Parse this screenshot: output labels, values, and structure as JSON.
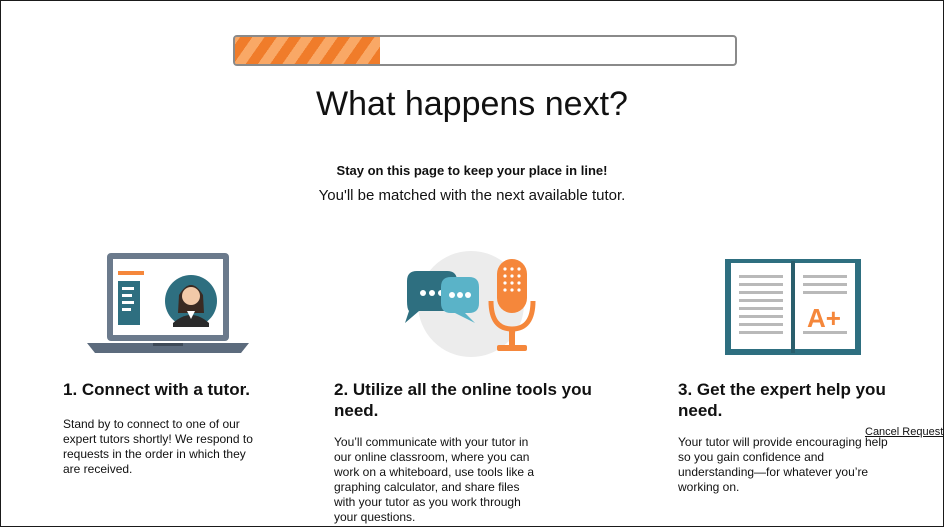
{
  "progress": {
    "fraction": 0.29
  },
  "heading": "What happens next?",
  "subtitle_bold": "Stay on this page to keep your place in line!",
  "subtitle": "You'll be matched with the next available tutor.",
  "steps": [
    {
      "icon": "laptop-tutor-icon",
      "title": "1. Connect with a tutor.",
      "description": "Stand by to connect to one of our expert tutors shortly! We respond to requests in the order in which they are received."
    },
    {
      "icon": "chat-microphone-icon",
      "title": "2. Utilize all the online tools you need.",
      "description": "You’ll communicate with your tutor in our online classroom, where you can work on a whiteboard, use tools like a graphing calculator, and share files with your tutor as you work through your questions."
    },
    {
      "icon": "open-book-grade-icon",
      "title": "3. Get the expert help you need.",
      "description": "Your tutor will provide encouraging help so you gain confidence and understanding—for whatever you’re working on."
    }
  ],
  "cancel_label": "Cancel Request",
  "colors": {
    "accent_orange": "#f5873b",
    "teal": "#2e6f80",
    "slate": "#5c6b7d",
    "chat_blue": "#5ab3c8"
  }
}
